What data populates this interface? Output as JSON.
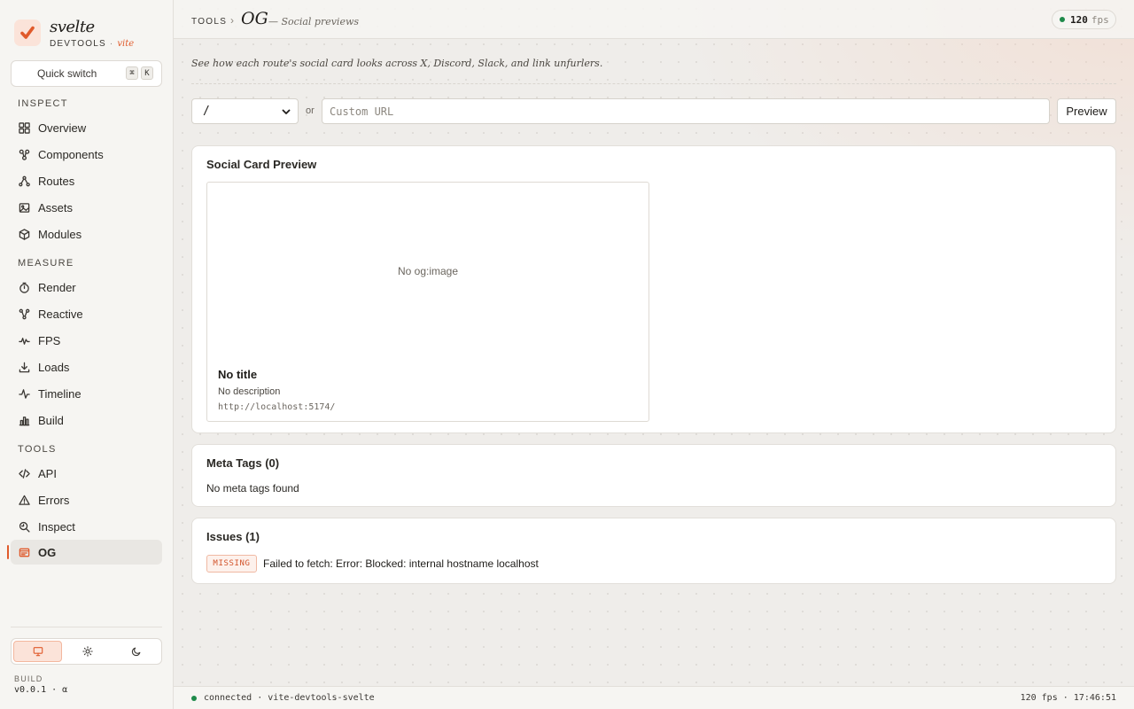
{
  "brand": {
    "name": "svelte",
    "sub_label": "DEVTOOLS",
    "separator": "·",
    "sub_accent": "vite"
  },
  "quick_switch": {
    "label": "Quick switch",
    "keys": [
      "⌘",
      "K"
    ]
  },
  "sidebar": {
    "sections": [
      {
        "label": "INSPECT",
        "items": [
          {
            "label": "Overview",
            "icon": "grid-icon"
          },
          {
            "label": "Components",
            "icon": "components-icon"
          },
          {
            "label": "Routes",
            "icon": "routes-icon"
          },
          {
            "label": "Assets",
            "icon": "image-icon"
          },
          {
            "label": "Modules",
            "icon": "cube-icon"
          }
        ]
      },
      {
        "label": "MEASURE",
        "items": [
          {
            "label": "Render",
            "icon": "stopwatch-icon"
          },
          {
            "label": "Reactive",
            "icon": "graph-icon"
          },
          {
            "label": "FPS",
            "icon": "pulse-icon"
          },
          {
            "label": "Loads",
            "icon": "download-icon"
          },
          {
            "label": "Timeline",
            "icon": "activity-icon"
          },
          {
            "label": "Build",
            "icon": "bar-chart-icon"
          }
        ]
      },
      {
        "label": "TOOLS",
        "items": [
          {
            "label": "API",
            "icon": "code-icon"
          },
          {
            "label": "Errors",
            "icon": "warning-icon"
          },
          {
            "label": "Inspect",
            "icon": "magnify-icon"
          },
          {
            "label": "OG",
            "icon": "card-icon",
            "active": true
          }
        ]
      }
    ],
    "theme_options": [
      "system",
      "light",
      "dark"
    ],
    "theme_selected": "system",
    "build_label": "BUILD",
    "build_version": "v0.0.1 · α"
  },
  "header": {
    "section": "TOOLS",
    "separator": "›",
    "page": "OG",
    "subtitle": "— Social previews",
    "fps_value": "120",
    "fps_unit": "fps"
  },
  "main": {
    "intro": "See how each route's social card looks across X, Discord, Slack, and link unfurlers.",
    "route_value": "/",
    "or_label": "or",
    "url_placeholder": "Custom URL",
    "preview_label": "Preview"
  },
  "social_card": {
    "section_title": "Social Card Preview",
    "image_placeholder": "No og:image",
    "title": "No title",
    "description": "No description",
    "url": "http://localhost:5174/"
  },
  "meta_tags": {
    "title": "Meta Tags (0)",
    "empty": "No meta tags found"
  },
  "issues": {
    "title": "Issues (1)",
    "items": [
      {
        "badge": "MISSING",
        "text": "Failed to fetch: Error: Blocked: internal hostname localhost"
      }
    ]
  },
  "status": {
    "connection": "connected",
    "separator": "·",
    "project": "vite-devtools-svelte",
    "fps": "120 fps",
    "time": "17:46:51"
  },
  "colors": {
    "accent": "#e05a2b",
    "connected": "#1e8a4a"
  }
}
